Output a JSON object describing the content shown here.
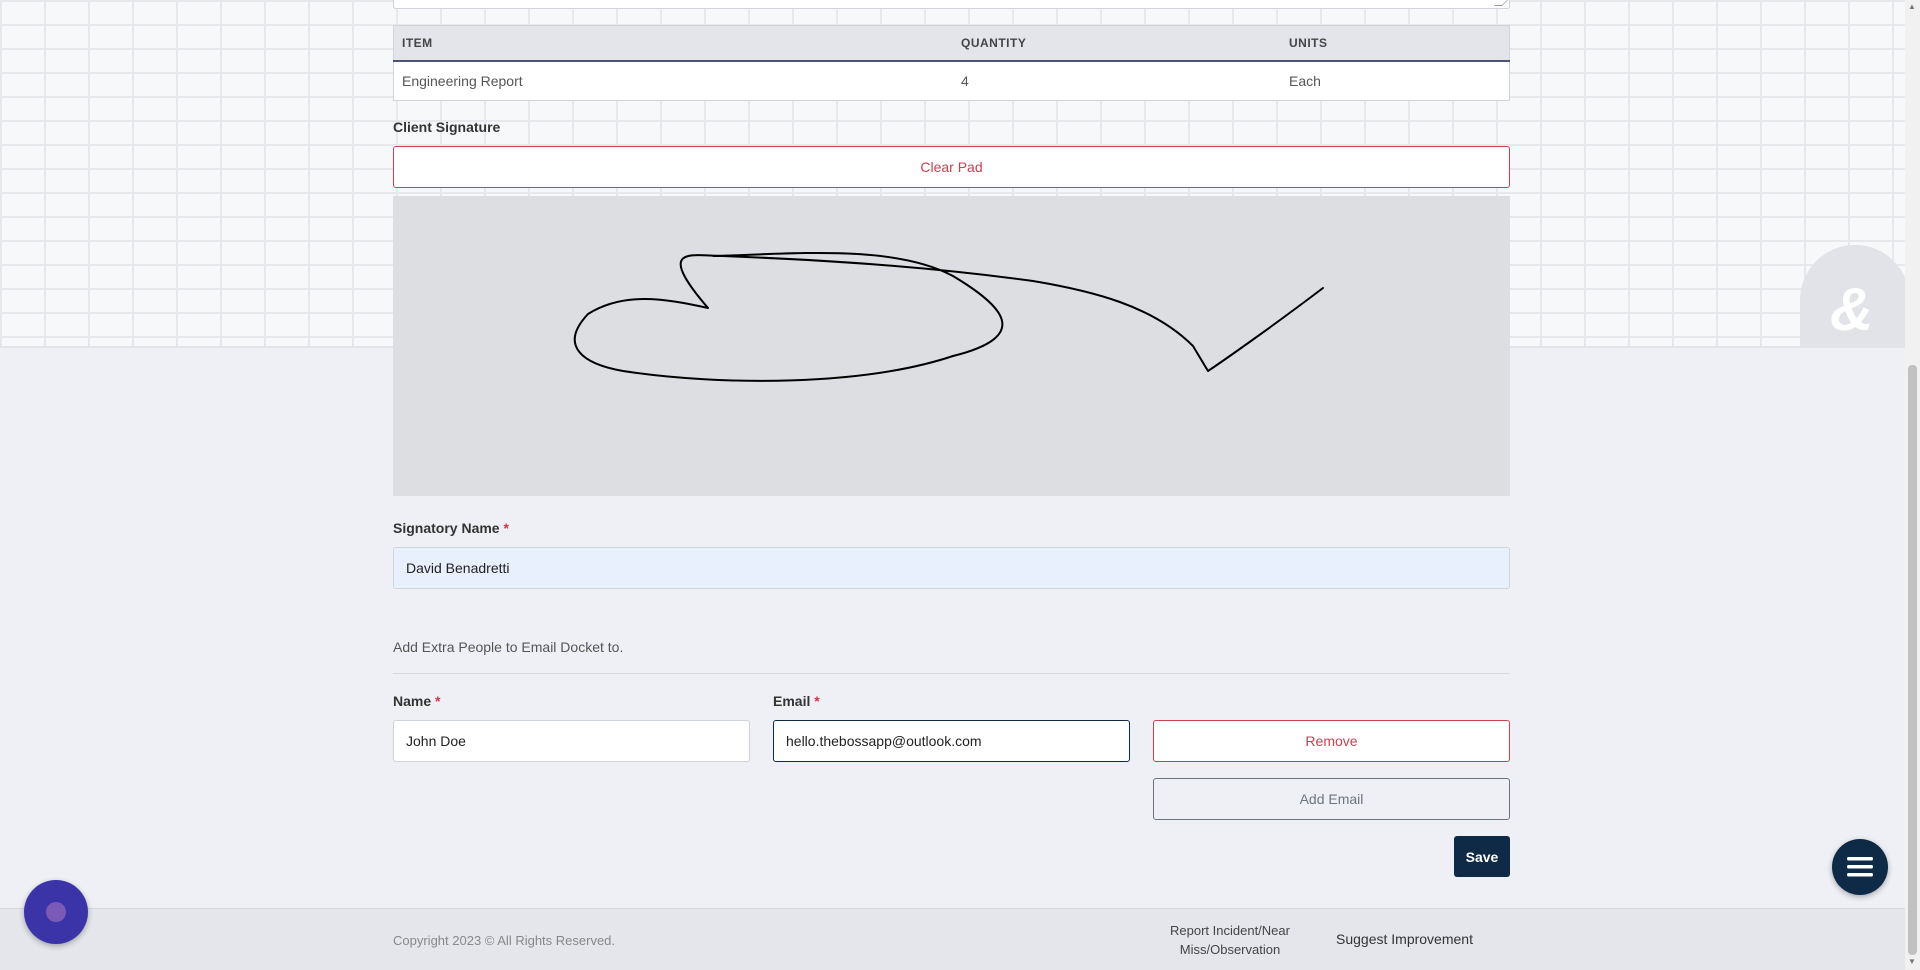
{
  "items_table": {
    "headers": [
      "ITEM",
      "QUANTITY",
      "UNITS"
    ],
    "rows": [
      [
        "Engineering Report",
        "4",
        "Each"
      ]
    ]
  },
  "signature": {
    "label": "Client Signature",
    "clear_button": "Clear Pad"
  },
  "signatory": {
    "label": "Signatory Name",
    "required_mark": "*",
    "value": "David Benadretti"
  },
  "extra_people": {
    "heading": "Add Extra People to Email Docket to.",
    "name_label": "Name",
    "email_label": "Email",
    "required_mark": "*",
    "name_value": "John Doe",
    "email_value": "hello.thebossapp@outlook.com",
    "remove_button": "Remove",
    "add_email_button": "Add Email"
  },
  "save_button": "Save",
  "footer": {
    "copyright": "Copyright 2023 © All Rights Reserved.",
    "report_incident": "Report Incident/Near Miss/Observation",
    "suggest": "Suggest Improvement"
  },
  "icons": {
    "menu_fab": "hamburger-menu-icon",
    "chat_fab": "chat-bubble-icon",
    "watermark": "logo-watermark-icon"
  },
  "colors": {
    "primary_dark": "#0e2a47",
    "danger": "#c9424f",
    "chat": "#3b34a8"
  }
}
